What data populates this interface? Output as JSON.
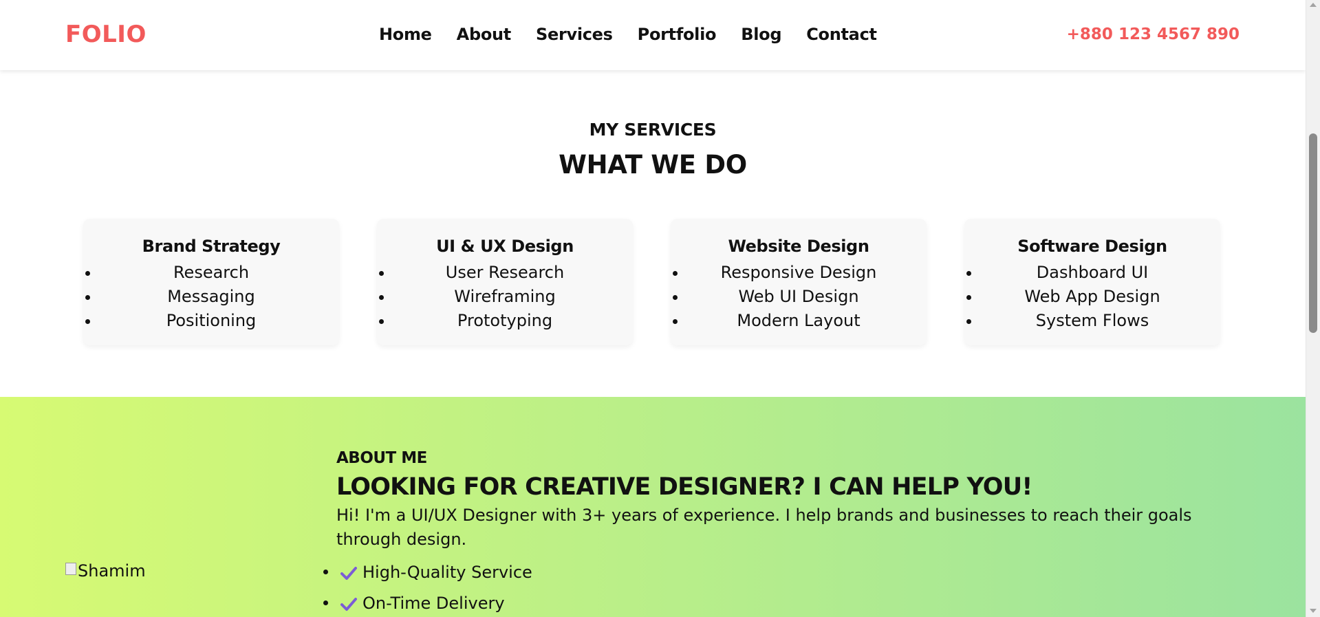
{
  "header": {
    "logo": "FOLIO",
    "nav": [
      "Home",
      "About",
      "Services",
      "Portfolio",
      "Blog",
      "Contact"
    ],
    "phone": "+880 123 4567 890"
  },
  "services": {
    "subtitle": "MY SERVICES",
    "title": "WHAT WE DO",
    "cards": [
      {
        "title": "Brand Strategy",
        "items": [
          "Research",
          "Messaging",
          "Positioning"
        ]
      },
      {
        "title": "UI & UX Design",
        "items": [
          "User Research",
          "Wireframing",
          "Prototyping"
        ]
      },
      {
        "title": "Website Design",
        "items": [
          "Responsive Design",
          "Web UI Design",
          "Modern Layout"
        ]
      },
      {
        "title": "Software Design",
        "items": [
          "Dashboard UI",
          "Web App Design",
          "System Flows"
        ]
      }
    ]
  },
  "about": {
    "image_alt": "Shamim",
    "subtitle": "ABOUT ME",
    "title": "LOOKING FOR CREATIVE DESIGNER? I CAN HELP YOU!",
    "text": "Hi! I'm a UI/UX Designer with 3+ years of experience. I help brands and businesses to reach their goals through design.",
    "features": [
      "High-Quality Service",
      "On-Time Delivery"
    ]
  },
  "colors": {
    "brand": "#f25a5a",
    "gradient_start": "#d7fa73",
    "gradient_end": "#9be39f",
    "check": "#7b5cd6"
  },
  "icons": {
    "feature": "check-icon"
  }
}
